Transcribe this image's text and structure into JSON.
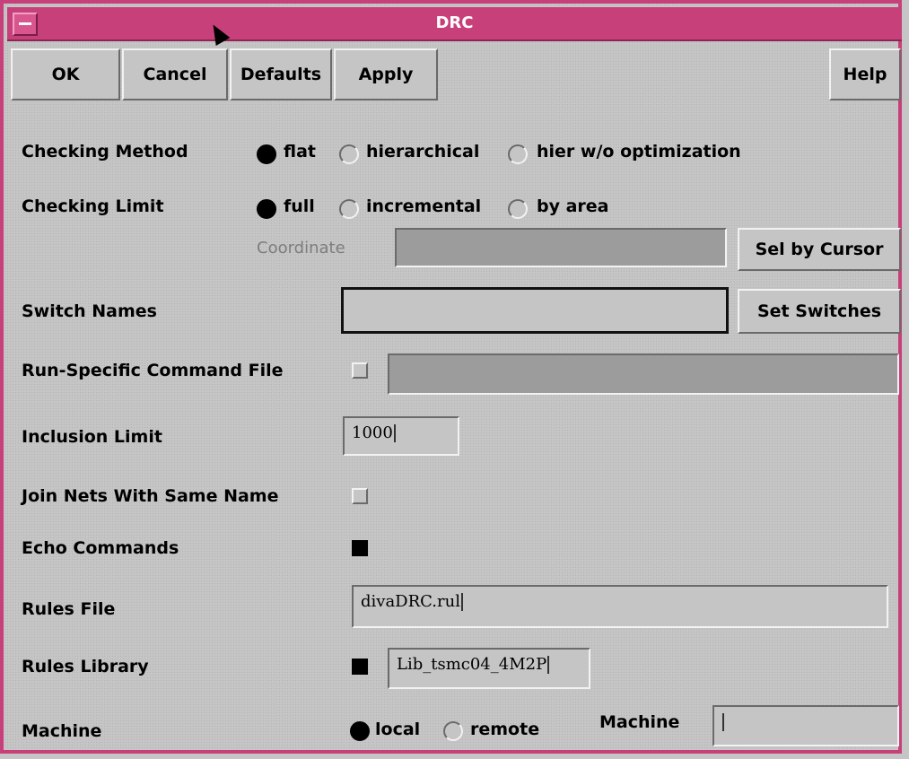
{
  "window": {
    "title": "DRC"
  },
  "toolbar": {
    "ok": "OK",
    "cancel": "Cancel",
    "defaults": "Defaults",
    "apply": "Apply",
    "help": "Help"
  },
  "checking_method": {
    "label": "Checking Method",
    "options": [
      "flat",
      "hierarchical",
      "hier w/o optimization"
    ],
    "selected": "flat"
  },
  "checking_limit": {
    "label": "Checking Limit",
    "options": [
      "full",
      "incremental",
      "by area"
    ],
    "selected": "full",
    "coordinate_label": "Coordinate",
    "coordinate_value": "",
    "sel_by_cursor": "Sel by Cursor"
  },
  "switch_names": {
    "label": "Switch Names",
    "value": "",
    "set_switches": "Set Switches"
  },
  "run_specific": {
    "label": "Run-Specific Command File",
    "checked": false,
    "value": ""
  },
  "inclusion_limit": {
    "label": "Inclusion Limit",
    "value": "1000"
  },
  "join_nets": {
    "label": "Join Nets With Same Name",
    "checked": false
  },
  "echo_commands": {
    "label": "Echo Commands",
    "checked": true
  },
  "rules_file": {
    "label": "Rules File",
    "value": "divaDRC.rul"
  },
  "rules_library": {
    "label": "Rules Library",
    "checked": true,
    "value": "Lib_tsmc04_4M2P"
  },
  "machine": {
    "label": "Machine",
    "options": [
      "local",
      "remote"
    ],
    "selected": "local",
    "machine_label": "Machine",
    "machine_value": ""
  },
  "colors": {
    "title_bar": "#c8407a",
    "panel": "#c5c5c5",
    "field_disabled": "#9c9c9c"
  },
  "icons": {
    "window_menu": "window-menu-icon",
    "pointer": "mouse-pointer-icon"
  }
}
